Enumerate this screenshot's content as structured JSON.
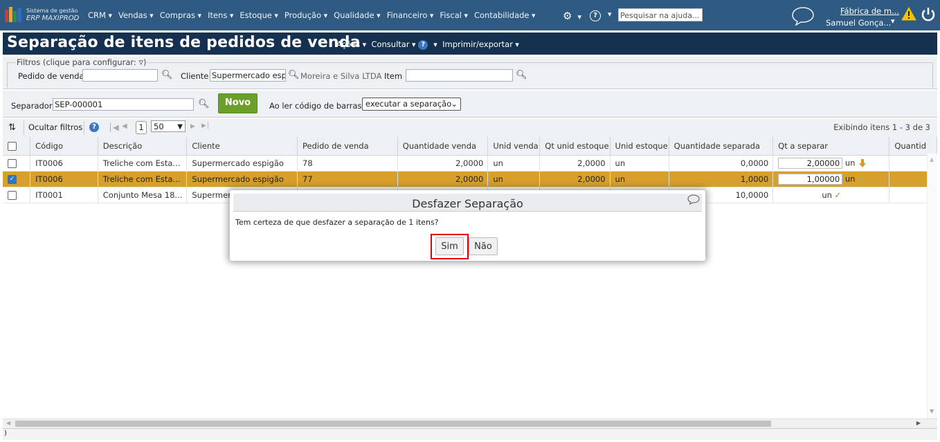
{
  "topbar": {
    "brand_line1": "Sistema de gestão",
    "brand_line2": "ERP MAXIPROD",
    "menu": [
      "CRM",
      "Vendas",
      "Compras",
      "Itens",
      "Estoque",
      "Produção",
      "Qualidade",
      "Financeiro",
      "Fiscal",
      "Contabilidade"
    ],
    "help_search_placeholder": "Pesquisar na ajuda...",
    "company": "Fábrica de m...",
    "user": "Samuel Gonça..."
  },
  "page": {
    "title": "Separação de itens de pedidos de venda",
    "menu_acoes": "Ações",
    "menu_consultar": "Consultar",
    "menu_imprimir": "Imprimir/exportar"
  },
  "filters": {
    "legend": "Filtros (clique para configurar:",
    "pedido_label": "Pedido de venda",
    "pedido_value": "",
    "cliente_label": "Cliente",
    "cliente_value": "Supermercado espigão",
    "cliente_name": "Moreira e Silva LTDA",
    "item_label": "Item",
    "item_value": ""
  },
  "separator_bar": {
    "label": "Separador",
    "value": "SEP-000001",
    "novo": "Novo",
    "barcode_label": "Ao ler código de barras:",
    "barcode_option": "executar a separação"
  },
  "toolbar": {
    "hide_filters": "Ocultar filtros",
    "page": "1",
    "page_size": "50",
    "showing": "Exibindo itens 1 - 3 de 3"
  },
  "grid": {
    "columns": [
      "Código",
      "Descrição",
      "Cliente",
      "Pedido de venda",
      "Quantidade venda",
      "Unid venda",
      "Qt unid estoque",
      "Unid estoque",
      "Quantidade separada",
      "Qt a separar",
      "Quantid"
    ],
    "rows": [
      {
        "checked": false,
        "codigo": "IT0006",
        "descricao": "Treliche com Esta...",
        "cliente": "Supermercado espigão",
        "pedido": "78",
        "qtd_venda": "2,0000",
        "unid_venda": "un",
        "qt_unid_estoque": "2,0000",
        "unid_estoque": "un",
        "qtd_separada": "0,0000",
        "qt_separar": "2,00000",
        "qt_unid": "un"
      },
      {
        "checked": true,
        "codigo": "IT0006",
        "descricao": "Treliche com Esta...",
        "cliente": "Supermercado espigão",
        "pedido": "77",
        "qtd_venda": "2,0000",
        "unid_venda": "un",
        "qt_unid_estoque": "2,0000",
        "unid_estoque": "un",
        "qtd_separada": "1,0000",
        "qt_separar": "1,00000",
        "qt_unid": "un"
      },
      {
        "checked": false,
        "codigo": "IT0001",
        "descricao": "Conjunto Mesa 18...",
        "cliente": "Supermerc",
        "pedido": "",
        "qtd_venda": "",
        "unid_venda": "",
        "qt_unid_estoque": "",
        "unid_estoque": "",
        "qtd_separada": "10,0000",
        "qt_separar": "",
        "qt_unid": "un"
      }
    ]
  },
  "dialog": {
    "title": "Desfazer Separação",
    "message": "Tem certeza de que desfazer a separação de 1 itens?",
    "yes": "Sim",
    "no": "Não"
  },
  "colors": {
    "topbar": "#2f5a82",
    "titlebar": "#16314f",
    "selected_row": "#d6a02a",
    "novo_button": "#6aa02a",
    "highlight": "#e0000f"
  }
}
